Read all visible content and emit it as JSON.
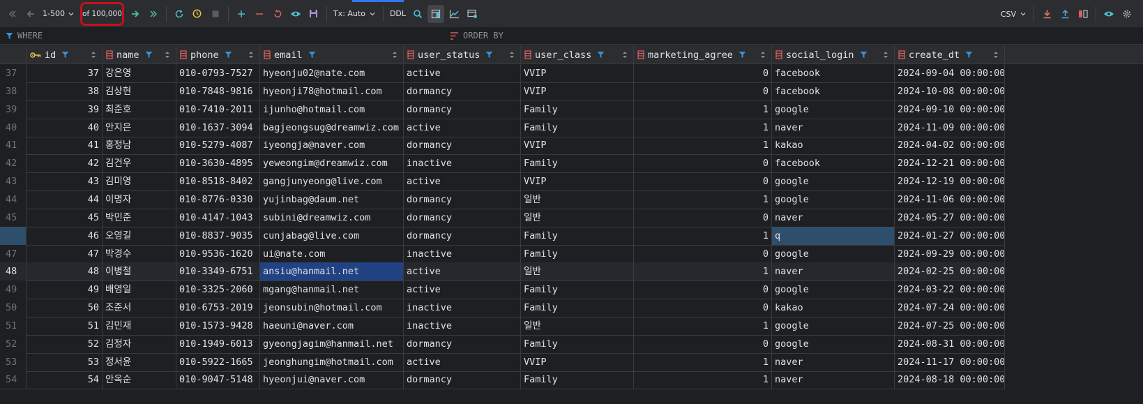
{
  "toolbar": {
    "range": "1-500",
    "row_count": "of 100,000",
    "tx_mode": "Tx: Auto",
    "ddl_label": "DDL",
    "export_format": "CSV"
  },
  "filter": {
    "where_label": "WHERE",
    "orderby_label": "ORDER BY"
  },
  "columns": [
    {
      "name": "id",
      "type": "key"
    },
    {
      "name": "name",
      "type": "col"
    },
    {
      "name": "phone",
      "type": "col"
    },
    {
      "name": "email",
      "type": "col"
    },
    {
      "name": "user_status",
      "type": "col"
    },
    {
      "name": "user_class",
      "type": "col"
    },
    {
      "name": "marketing_agree",
      "type": "col"
    },
    {
      "name": "social_login",
      "type": "col"
    },
    {
      "name": "create_dt",
      "type": "col"
    }
  ],
  "rows": [
    {
      "rn": "37",
      "id": "37",
      "name": "강은영",
      "phone": "010-0793-7527",
      "email": "hyeonju02@nate.com",
      "user_status": "active",
      "user_class": "VVIP",
      "marketing_agree": "0",
      "social_login": "facebook",
      "create_dt": "2024-09-04 00:00:00"
    },
    {
      "rn": "38",
      "id": "38",
      "name": "김상현",
      "phone": "010-7848-9816",
      "email": "hyeonji78@hotmail.com",
      "user_status": "dormancy",
      "user_class": "VVIP",
      "marketing_agree": "0",
      "social_login": "facebook",
      "create_dt": "2024-10-08 00:00:00"
    },
    {
      "rn": "39",
      "id": "39",
      "name": "최준호",
      "phone": "010-7410-2011",
      "email": "ijunho@hotmail.com",
      "user_status": "dormancy",
      "user_class": "Family",
      "marketing_agree": "1",
      "social_login": "google",
      "create_dt": "2024-09-10 00:00:00"
    },
    {
      "rn": "40",
      "id": "40",
      "name": "안지은",
      "phone": "010-1637-3094",
      "email": "bagjeongsug@dreamwiz.com",
      "user_status": "active",
      "user_class": "Family",
      "marketing_agree": "1",
      "social_login": "naver",
      "create_dt": "2024-11-09 00:00:00"
    },
    {
      "rn": "41",
      "id": "41",
      "name": "홍정남",
      "phone": "010-5279-4087",
      "email": "iyeongja@naver.com",
      "user_status": "dormancy",
      "user_class": "VVIP",
      "marketing_agree": "1",
      "social_login": "kakao",
      "create_dt": "2024-04-02 00:00:00"
    },
    {
      "rn": "42",
      "id": "42",
      "name": "김건우",
      "phone": "010-3630-4895",
      "email": "yeweongim@dreamwiz.com",
      "user_status": "inactive",
      "user_class": "Family",
      "marketing_agree": "0",
      "social_login": "facebook",
      "create_dt": "2024-12-21 00:00:00"
    },
    {
      "rn": "43",
      "id": "43",
      "name": "김미영",
      "phone": "010-8518-8402",
      "email": "gangjunyeong@live.com",
      "user_status": "active",
      "user_class": "VVIP",
      "marketing_agree": "0",
      "social_login": "google",
      "create_dt": "2024-12-19 00:00:00"
    },
    {
      "rn": "44",
      "id": "44",
      "name": "이명자",
      "phone": "010-8776-0330",
      "email": "yujinbag@daum.net",
      "user_status": "dormancy",
      "user_class": "일반",
      "marketing_agree": "1",
      "social_login": "google",
      "create_dt": "2024-11-06 00:00:00"
    },
    {
      "rn": "45",
      "id": "45",
      "name": "박민준",
      "phone": "010-4147-1043",
      "email": "subini@dreamwiz.com",
      "user_status": "dormancy",
      "user_class": "일반",
      "marketing_agree": "0",
      "social_login": "naver",
      "create_dt": "2024-05-27 00:00:00"
    },
    {
      "rn": "",
      "id": "46",
      "name": "오영길",
      "phone": "010-8837-9035",
      "email": "cunjabag@live.com",
      "user_status": "dormancy",
      "user_class": "Family",
      "marketing_agree": "1",
      "social_login": "q",
      "create_dt": "2024-01-27 00:00:00"
    },
    {
      "rn": "47",
      "id": "47",
      "name": "박경수",
      "phone": "010-9536-1620",
      "email": "ui@nate.com",
      "user_status": "inactive",
      "user_class": "Family",
      "marketing_agree": "0",
      "social_login": "google",
      "create_dt": "2024-09-29 00:00:00"
    },
    {
      "rn": "48",
      "id": "48",
      "name": "이병철",
      "phone": "010-3349-6751",
      "email": "ansiu@hanmail.net",
      "user_status": "active",
      "user_class": "일반",
      "marketing_agree": "1",
      "social_login": "naver",
      "create_dt": "2024-02-25 00:00:00"
    },
    {
      "rn": "49",
      "id": "49",
      "name": "배영일",
      "phone": "010-3325-2060",
      "email": "mgang@hanmail.net",
      "user_status": "active",
      "user_class": "Family",
      "marketing_agree": "0",
      "social_login": "google",
      "create_dt": "2024-03-22 00:00:00"
    },
    {
      "rn": "50",
      "id": "50",
      "name": "조준서",
      "phone": "010-6753-2019",
      "email": "jeonsubin@hotmail.com",
      "user_status": "inactive",
      "user_class": "Family",
      "marketing_agree": "0",
      "social_login": "kakao",
      "create_dt": "2024-07-24 00:00:00"
    },
    {
      "rn": "51",
      "id": "51",
      "name": "김민재",
      "phone": "010-1573-9428",
      "email": "haeuni@naver.com",
      "user_status": "inactive",
      "user_class": "일반",
      "marketing_agree": "1",
      "social_login": "google",
      "create_dt": "2024-07-25 00:00:00"
    },
    {
      "rn": "52",
      "id": "52",
      "name": "김정자",
      "phone": "010-1949-6013",
      "email": "gyeongjagim@hanmail.net",
      "user_status": "dormancy",
      "user_class": "Family",
      "marketing_agree": "0",
      "social_login": "google",
      "create_dt": "2024-08-31 00:00:00"
    },
    {
      "rn": "53",
      "id": "53",
      "name": "정서윤",
      "phone": "010-5922-1665",
      "email": "jeonghungim@hotmail.com",
      "user_status": "active",
      "user_class": "VVIP",
      "marketing_agree": "1",
      "social_login": "naver",
      "create_dt": "2024-11-17 00:00:00"
    },
    {
      "rn": "54",
      "id": "54",
      "name": "안옥순",
      "phone": "010-9047-5148",
      "email": "hyeonjui@naver.com",
      "user_status": "dormancy",
      "user_class": "Family",
      "marketing_agree": "1",
      "social_login": "naver",
      "create_dt": "2024-08-18 00:00:00"
    }
  ],
  "colors": {
    "accent": "#3574f0",
    "highlight_box": "#c8101a",
    "filter_icon": "#3d8fd8",
    "column_icon": "#d95e5e",
    "key_icon": "#e5c046"
  }
}
